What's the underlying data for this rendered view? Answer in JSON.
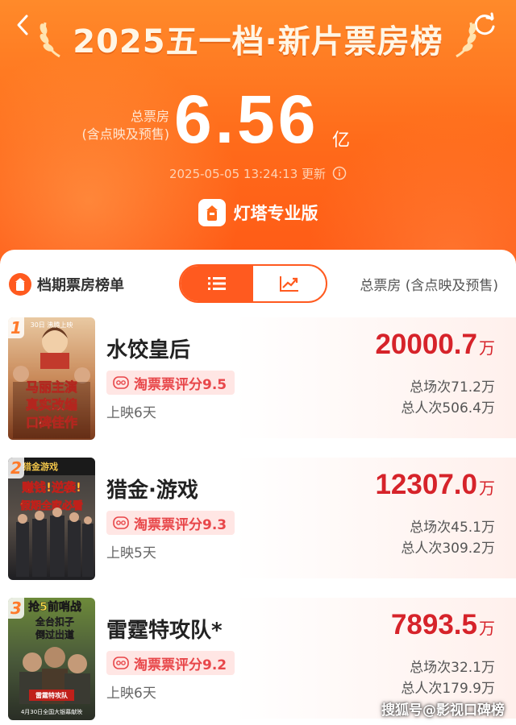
{
  "header": {
    "title": "2025五一档·新片票房榜",
    "total_label_line1": "总票房",
    "total_label_line2": "(含点映及预售)",
    "total_value": "6.56",
    "total_unit": "亿",
    "update_time": "2025-05-05 13:24:13 更新",
    "brand": "灯塔专业版"
  },
  "list": {
    "title": "档期票房榜单",
    "sum_label": "总票房 (含点映及预售)",
    "view_mode": "list"
  },
  "movies": [
    {
      "rank": "1",
      "name": "水饺皇后",
      "rating": "淘票票评分9.5",
      "days": "上映6天",
      "box": "20000.7",
      "unit": "万",
      "shows": "总场次71.2万",
      "people": "总人次506.4万",
      "poster_caption": [
        "马丽主演",
        "真实改编",
        "口碑佳作"
      ],
      "poster_top": "30日 沸腾上映"
    },
    {
      "rank": "2",
      "name": "猎金·游戏",
      "rating": "淘票票评分9.3",
      "days": "上映5天",
      "box": "12307.0",
      "unit": "万",
      "shows": "总场次45.1万",
      "people": "总人次309.2万",
      "poster_caption": [
        "赚钱!逆袭!",
        "假期全家必看"
      ],
      "poster_top": "猎金游戏"
    },
    {
      "rank": "3",
      "name": "雷霆特攻队*",
      "rating": "淘票票评分9.2",
      "days": "上映6天",
      "box": "7893.5",
      "unit": "万",
      "shows": "总场次32.1万",
      "people": "总人次179.9万",
      "poster_caption": [
        "抢5前哨战",
        "全台扣子",
        "倒过出道"
      ],
      "poster_top": "雷霆特攻队",
      "poster_bottom": "4月30日全国大银幕献映"
    }
  ],
  "watermark": "搜狐号@影视口碑榜",
  "colors": {
    "hero_top": "#ff8a2a",
    "hero_bottom": "#ff5a16",
    "accent": "#ff5a1f",
    "box_red": "#d6232a",
    "rating_bg": "#ffe6e4",
    "rating_text": "#e8474a"
  }
}
